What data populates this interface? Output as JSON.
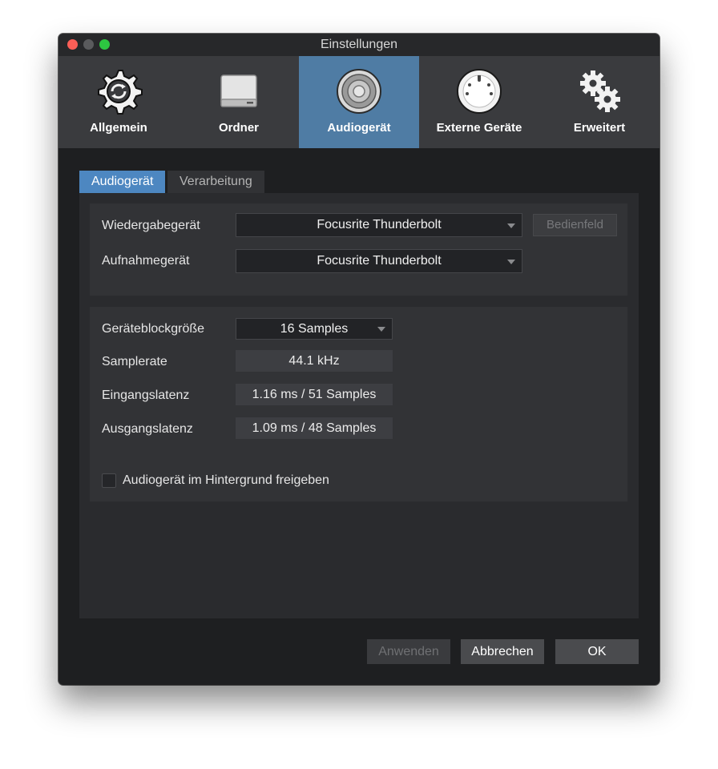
{
  "window": {
    "title": "Einstellungen"
  },
  "toolbar": {
    "items": [
      {
        "label": "Allgemein",
        "icon": "sync-gear-icon",
        "active": false
      },
      {
        "label": "Ordner",
        "icon": "drive-icon",
        "active": false
      },
      {
        "label": "Audiogerät",
        "icon": "speaker-icon",
        "active": true
      },
      {
        "label": "Externe Geräte",
        "icon": "midi-connector-icon",
        "active": false
      },
      {
        "label": "Erweitert",
        "icon": "gears-icon",
        "active": false
      }
    ]
  },
  "tabs": [
    {
      "label": "Audiogerät",
      "active": true
    },
    {
      "label": "Verarbeitung",
      "active": false
    }
  ],
  "devices": {
    "playback_label": "Wiedergabegerät",
    "playback_value": "Focusrite Thunderbolt",
    "control_panel_label": "Bedienfeld",
    "record_label": "Aufnahmegerät",
    "record_value": "Focusrite Thunderbolt"
  },
  "settings": {
    "blocksize_label": "Geräteblockgröße",
    "blocksize_value": "16 Samples",
    "samplerate_label": "Samplerate",
    "samplerate_value": "44.1 kHz",
    "input_latency_label": "Eingangslatenz",
    "input_latency_value": "1.16 ms / 51 Samples",
    "output_latency_label": "Ausgangslatenz",
    "output_latency_value": "1.09 ms / 48 Samples",
    "background_release_label": "Audiogerät im Hintergrund freigeben",
    "background_release_checked": false
  },
  "footer": {
    "apply_label": "Anwenden",
    "cancel_label": "Abbrechen",
    "ok_label": "OK"
  },
  "colors": {
    "accent": "#4f7ca4",
    "tab_active": "#4d87c1"
  }
}
